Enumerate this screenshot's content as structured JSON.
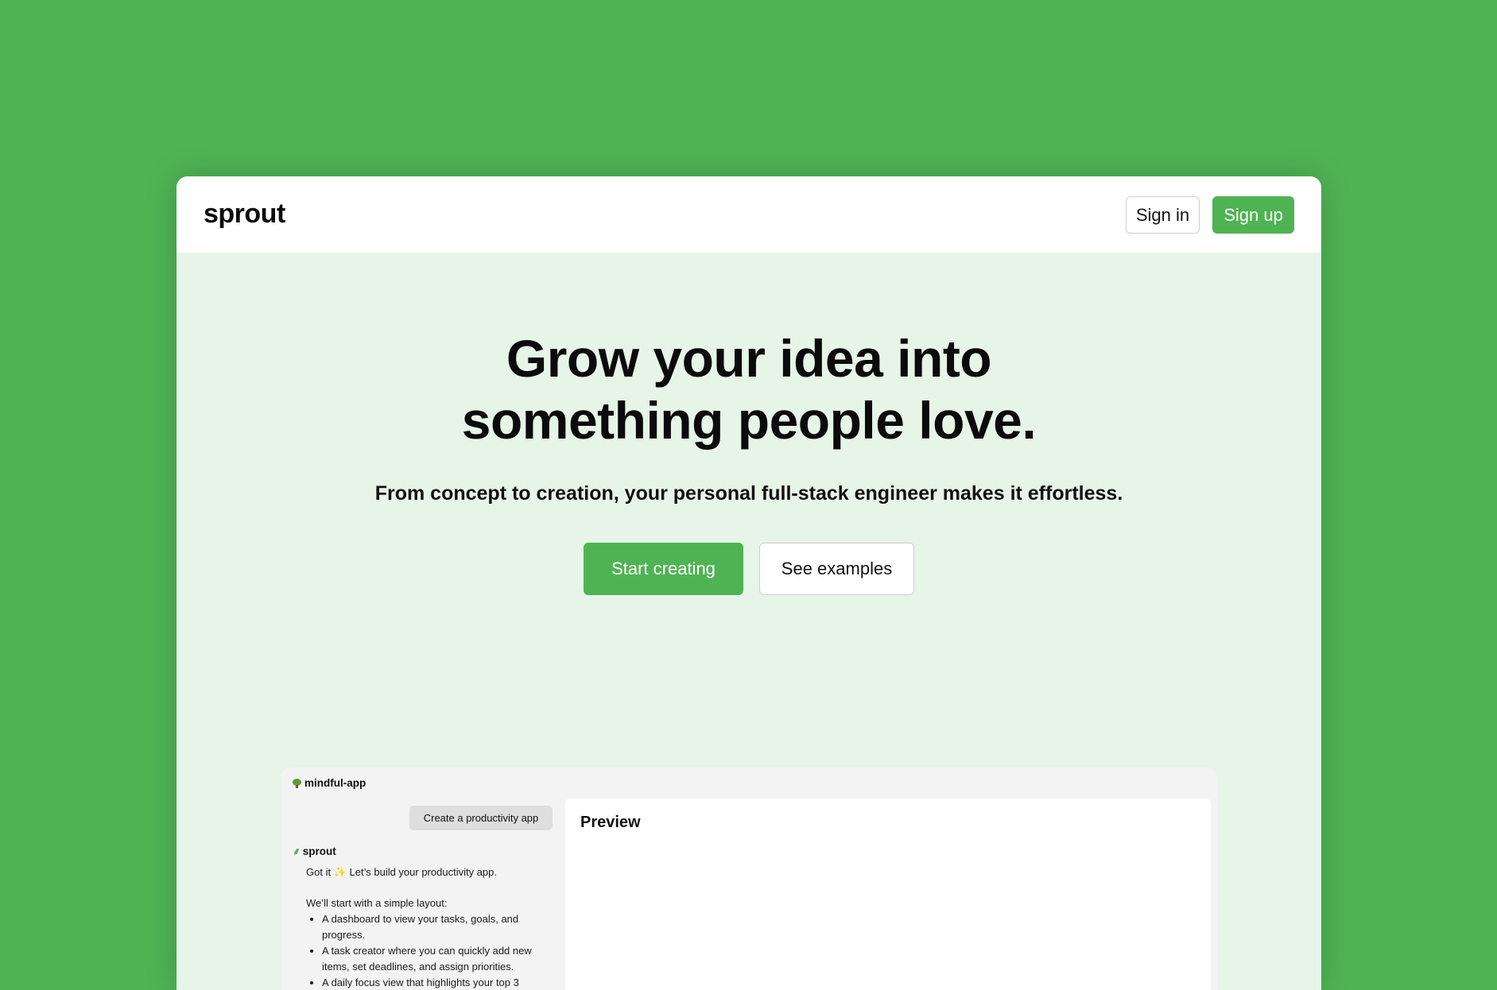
{
  "nav": {
    "logo": "sprout",
    "sign_in": "Sign in",
    "sign_up": "Sign up"
  },
  "hero": {
    "title_line1": "Grow your idea into",
    "title_line2": "something people love.",
    "subtitle": "From concept to creation, your personal full-stack engineer makes it effortless.",
    "primary_cta": "Start creating",
    "secondary_cta": "See examples"
  },
  "mock": {
    "project_name": "mindful-app",
    "user_prompt": "Create a productivity app",
    "bot_name": "sprout",
    "reply_intro_prefix": "Got it",
    "reply_intro_suffix": "Let’s build your productivity app.",
    "layout_intro": "We’ll start with a simple layout:",
    "bullets": [
      "A dashboard to view your tasks, goals, and progress.",
      "A task creator where you can quickly add new items, set deadlines, and assign priorities.",
      "A daily focus view that highlights your top 3"
    ],
    "preview_title": "Preview"
  },
  "colors": {
    "brand_green": "#4fb354",
    "hero_background": "#e7f4e8"
  },
  "icons": {
    "project": "tree-icon",
    "bot": "sprout-icon",
    "sparkle": "sparkle-icon"
  }
}
